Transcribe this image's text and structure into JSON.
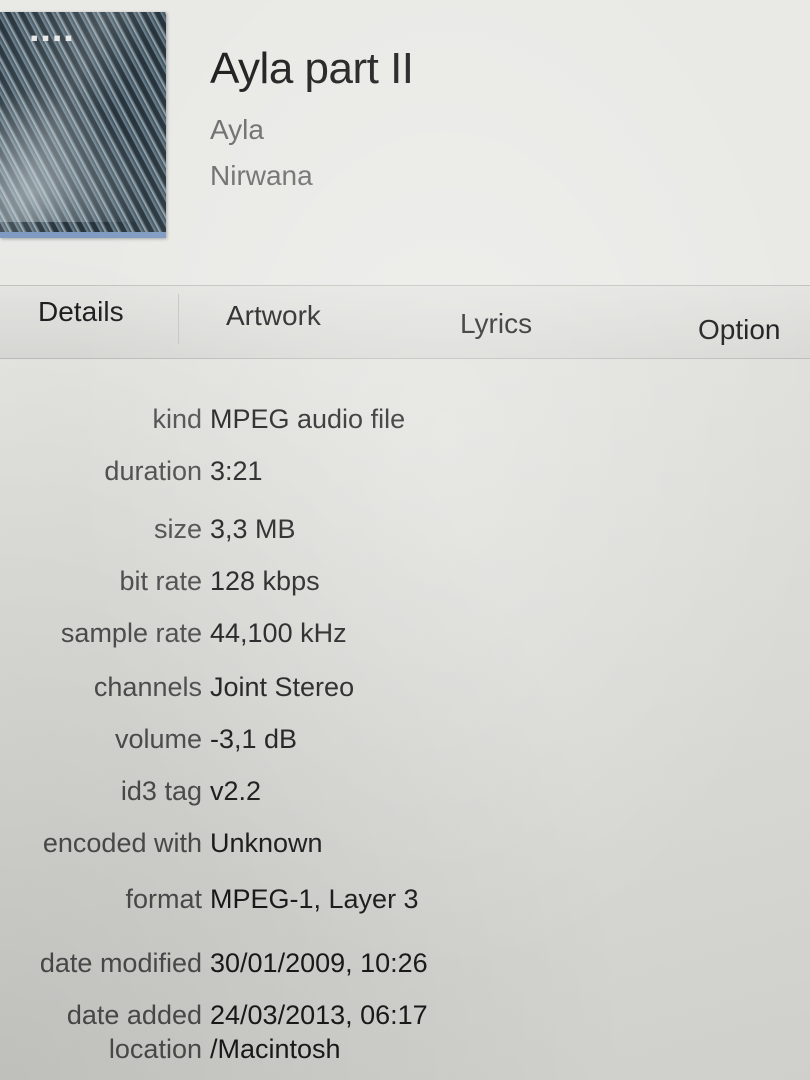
{
  "header": {
    "title": "Ayla part II",
    "artist": "Ayla",
    "album": "Nirwana"
  },
  "tabs": [
    {
      "label": "Details"
    },
    {
      "label": "Artwork"
    },
    {
      "label": "Lyrics"
    },
    {
      "label": "Option"
    }
  ],
  "details": [
    {
      "label": "kind",
      "value": "MPEG audio file"
    },
    {
      "label": "duration",
      "value": "3:21"
    },
    {
      "label": "size",
      "value": "3,3 MB"
    },
    {
      "label": "bit rate",
      "value": "128 kbps"
    },
    {
      "label": "sample rate",
      "value": "44,100 kHz"
    },
    {
      "label": "channels",
      "value": "Joint Stereo"
    },
    {
      "label": "volume",
      "value": "-3,1 dB"
    },
    {
      "label": "id3 tag",
      "value": "v2.2"
    },
    {
      "label": "encoded with",
      "value": "Unknown"
    },
    {
      "label": "format",
      "value": "MPEG-1, Layer 3"
    },
    {
      "label": "date modified",
      "value": "30/01/2009, 10:26"
    },
    {
      "label": "date added",
      "value": "24/03/2013, 06:17"
    },
    {
      "label": "location",
      "value": "/Macintosh"
    }
  ],
  "colors": {
    "background": "#e2e2de",
    "text": "#1a1a1a",
    "label": "#4d4d4d",
    "artwork_border": "#7f9bc1"
  }
}
